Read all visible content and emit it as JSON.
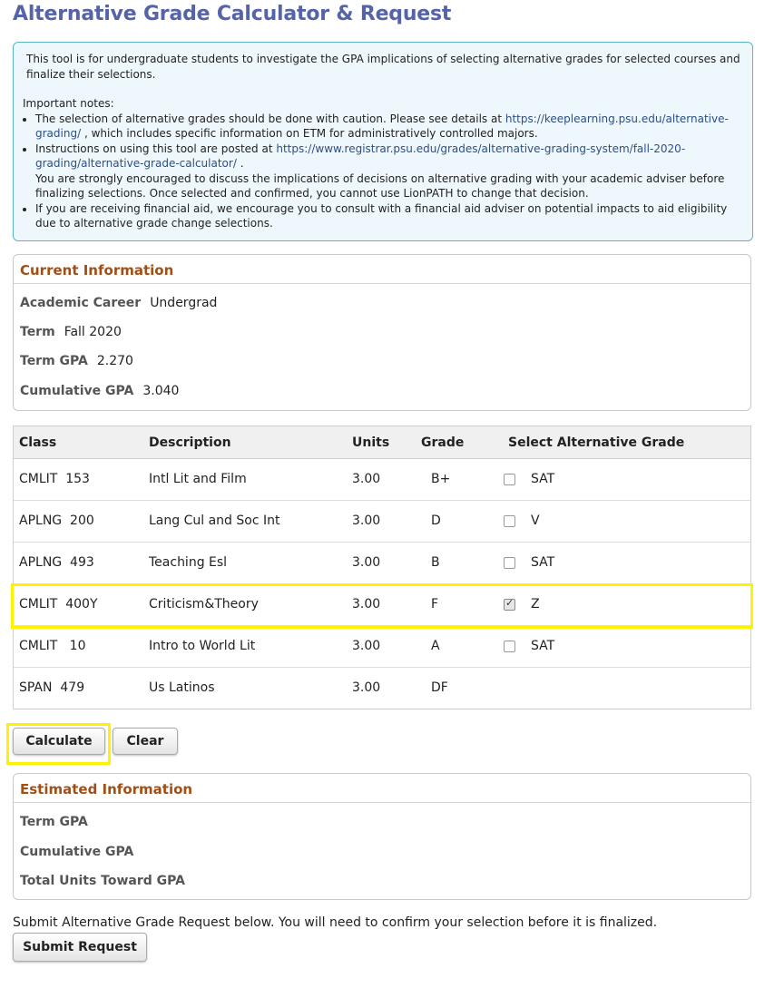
{
  "page": {
    "title": "Alternative Grade Calculator & Request"
  },
  "notice": {
    "intro": "This tool is for undergraduate students to investigate the GPA implications of selecting alternative grades for selected courses and finalize their selections.",
    "heading": "Important notes:",
    "bullet1_pre": "The selection of alternative grades should be done with caution. Please see details at ",
    "bullet1_link": "https://keeplearning.psu.edu/alternative-grading/",
    "bullet1_post": " , which includes specific information on ETM for administratively controlled majors.",
    "bullet2_pre": "Instructions on using this tool are posted at ",
    "bullet2_link": "https://www.registrar.psu.edu/grades/alternative-grading-system/fall-2020-grading/alternative-grade-calculator/",
    "bullet2_post": " .",
    "bullet2_extra": "You are strongly encouraged to discuss the implications of decisions on alternative grading with your academic adviser before finalizing selections. Once selected and confirmed, you cannot use LionPATH to change that decision.",
    "bullet3": "If you are receiving financial aid, we encourage you to consult with a financial aid adviser on potential impacts to aid eligibility due to alternative grade change selections."
  },
  "current": {
    "heading": "Current Information",
    "career_label": "Academic Career",
    "career_value": "Undergrad",
    "term_label": "Term",
    "term_value": "Fall 2020",
    "termgpa_label": "Term GPA",
    "termgpa_value": "2.270",
    "cumgpa_label": "Cumulative GPA",
    "cumgpa_value": "3.040"
  },
  "table": {
    "headers": {
      "class": "Class",
      "description": "Description",
      "units": "Units",
      "grade": "Grade",
      "select": "Select Alternative Grade"
    },
    "rows": [
      {
        "class": "CMLIT  153",
        "description": "Intl Lit and Film",
        "units": "3.00",
        "grade": "B+",
        "alt": "SAT",
        "checked": false
      },
      {
        "class": "APLNG  200",
        "description": "Lang Cul and Soc Int",
        "units": "3.00",
        "grade": "D",
        "alt": "V",
        "checked": false
      },
      {
        "class": "APLNG  493",
        "description": "Teaching Esl",
        "units": "3.00",
        "grade": "B",
        "alt": "SAT",
        "checked": false
      },
      {
        "class": "CMLIT  400Y",
        "description": "Criticism&Theory",
        "units": "3.00",
        "grade": "F",
        "alt": "Z",
        "checked": true
      },
      {
        "class": "CMLIT   10",
        "description": "Intro to World Lit",
        "units": "3.00",
        "grade": "A",
        "alt": "SAT",
        "checked": false
      },
      {
        "class": "SPAN  479",
        "description": "Us Latinos",
        "units": "3.00",
        "grade": "DF",
        "alt": "",
        "checked": false
      }
    ]
  },
  "buttons": {
    "calculate": "Calculate",
    "clear": "Clear",
    "submit": "Submit Request"
  },
  "estimated": {
    "heading": "Estimated Information",
    "termgpa_label": "Term GPA",
    "cumgpa_label": "Cumulative GPA",
    "units_label": "Total Units Toward GPA"
  },
  "submit_note": "Submit Alternative Grade Request below. You will need to confirm your selection before it is finalized.",
  "colors": {
    "title": "#5563a8",
    "section_heading": "#a24f16",
    "highlight": "#fff200",
    "notice_bg": "#eef7fb",
    "notice_border": "#5bb5c9"
  }
}
